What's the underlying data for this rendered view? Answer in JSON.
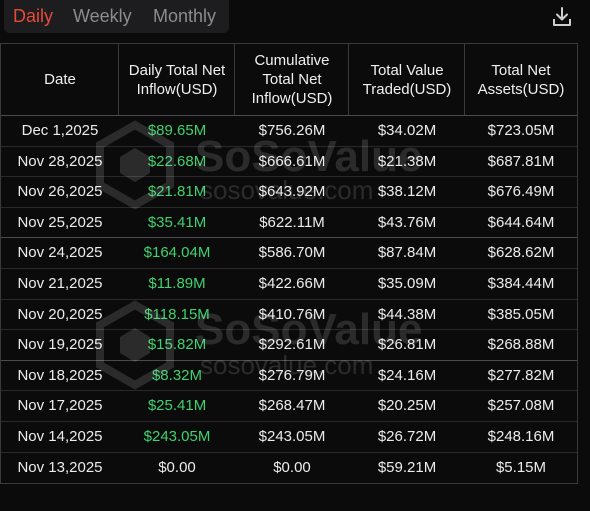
{
  "tabs": [
    {
      "label": "Daily",
      "active": true
    },
    {
      "label": "Weekly",
      "active": false
    },
    {
      "label": "Monthly",
      "active": false
    }
  ],
  "icons": {
    "download": "download-icon"
  },
  "colors": {
    "active_tab": "#e8483b",
    "positive": "#3fd26e",
    "text": "#ececec",
    "background": "#0b0b0c"
  },
  "table": {
    "headers": [
      "Date",
      "Daily Total Net\nInflow(USD)",
      "Cumulative\nTotal Net\nInflow(USD)",
      "Total Value\nTraded(USD)",
      "Total Net\nAssets(USD)"
    ],
    "rows": [
      {
        "date": "Dec 1,2025",
        "daily": "$89.65M",
        "cumulative": "$756.26M",
        "traded": "$34.02M",
        "assets": "$723.05M",
        "positive": true
      },
      {
        "date": "Nov 28,2025",
        "daily": "$22.68M",
        "cumulative": "$666.61M",
        "traded": "$21.38M",
        "assets": "$687.81M",
        "positive": true
      },
      {
        "date": "Nov 26,2025",
        "daily": "$21.81M",
        "cumulative": "$643.92M",
        "traded": "$38.12M",
        "assets": "$676.49M",
        "positive": true
      },
      {
        "date": "Nov 25,2025",
        "daily": "$35.41M",
        "cumulative": "$622.11M",
        "traded": "$43.76M",
        "assets": "$644.64M",
        "positive": true
      },
      {
        "date": "Nov 24,2025",
        "daily": "$164.04M",
        "cumulative": "$586.70M",
        "traded": "$87.84M",
        "assets": "$628.62M",
        "positive": true
      },
      {
        "date": "Nov 21,2025",
        "daily": "$11.89M",
        "cumulative": "$422.66M",
        "traded": "$35.09M",
        "assets": "$384.44M",
        "positive": true
      },
      {
        "date": "Nov 20,2025",
        "daily": "$118.15M",
        "cumulative": "$410.76M",
        "traded": "$44.38M",
        "assets": "$385.05M",
        "positive": true
      },
      {
        "date": "Nov 19,2025",
        "daily": "$15.82M",
        "cumulative": "$292.61M",
        "traded": "$26.81M",
        "assets": "$268.88M",
        "positive": true
      },
      {
        "date": "Nov 18,2025",
        "daily": "$8.32M",
        "cumulative": "$276.79M",
        "traded": "$24.16M",
        "assets": "$277.82M",
        "positive": true
      },
      {
        "date": "Nov 17,2025",
        "daily": "$25.41M",
        "cumulative": "$268.47M",
        "traded": "$20.25M",
        "assets": "$257.08M",
        "positive": true
      },
      {
        "date": "Nov 14,2025",
        "daily": "$243.05M",
        "cumulative": "$243.05M",
        "traded": "$26.72M",
        "assets": "$248.16M",
        "positive": true
      },
      {
        "date": "Nov 13,2025",
        "daily": "$0.00",
        "cumulative": "$0.00",
        "traded": "$59.21M",
        "assets": "$5.15M",
        "positive": false
      }
    ]
  },
  "watermark": {
    "brand": "SoSoValue",
    "url": "sosovalue.com"
  }
}
